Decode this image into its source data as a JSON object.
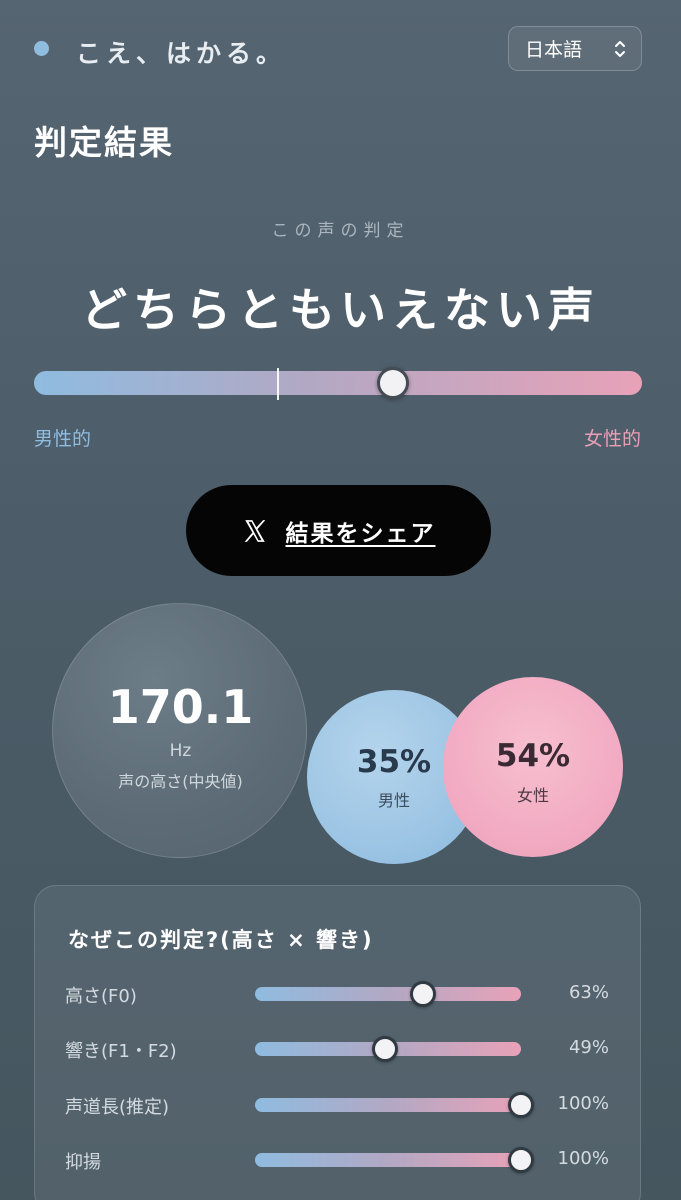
{
  "brand": {
    "name": "こえ、はかる。",
    "dot_color": "#8fbde0"
  },
  "language_select": {
    "value": "日本語",
    "icon": "chevron-updown-icon"
  },
  "page_title": "判定結果",
  "result": {
    "label": "この声の判定",
    "value": "どちらともいえない声",
    "gauge_position": 0.59,
    "left_label": "男性的",
    "right_label": "女性的"
  },
  "share": {
    "label": "結果をシェア",
    "icon": "x-logo-icon"
  },
  "pitch": {
    "value": "170.1",
    "unit": "Hz",
    "caption": "声の高さ(中央値)"
  },
  "male": {
    "percent": "35%",
    "label": "男性"
  },
  "female": {
    "percent": "54%",
    "label": "女性"
  },
  "why": {
    "title": "なぜこの判定?(高さ × 響き)",
    "metrics": [
      {
        "label": "高さ(F0)",
        "value": 0.63,
        "percent": "63%"
      },
      {
        "label": "響き(F1・F2)",
        "value": 0.49,
        "percent": "49%"
      },
      {
        "label": "声道長(推定)",
        "value": 1.0,
        "percent": "100%"
      },
      {
        "label": "抑揚",
        "value": 1.0,
        "percent": "100%"
      }
    ]
  },
  "colors": {
    "male": "#8fbde0",
    "female": "#e9a0b5",
    "button": "#050505"
  }
}
